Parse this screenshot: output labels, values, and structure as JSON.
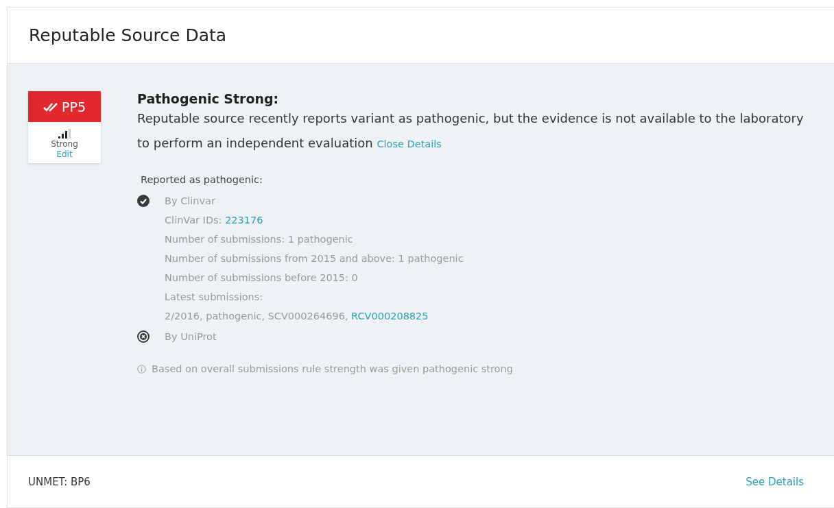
{
  "card": {
    "title": "Reputable Source Data"
  },
  "criterion": {
    "code": "PP5",
    "strength_label": "Strong",
    "edit": "Edit"
  },
  "summary": {
    "heading": "Pathogenic Strong:",
    "text": "Reputable source recently reports variant as pathogenic, but the evidence is not available to the laboratory to perform an independent evaluation",
    "toggle": "Close Details"
  },
  "details": {
    "heading": "Reported as pathogenic:",
    "sources": [
      {
        "kind": "met",
        "name": "By Clinvar",
        "lines": [
          {
            "text": "ClinVar IDs: ",
            "link": "223176"
          },
          {
            "text": "Number of submissions: 1 pathogenic"
          },
          {
            "text": "Number of submissions from 2015 and above: 1 pathogenic"
          },
          {
            "text": "Number of submissions before 2015: 0"
          },
          {
            "text": "Latest submissions:"
          },
          {
            "text": "2/2016, pathogenic, SCV000264696, ",
            "link": "RCV000208825"
          }
        ]
      },
      {
        "kind": "unmet",
        "name": "By UniProt"
      }
    ],
    "note": "Based on overall submissions rule strength was given pathogenic strong"
  },
  "footer": {
    "label": "UNMET:  BP6",
    "link": "See Details"
  }
}
